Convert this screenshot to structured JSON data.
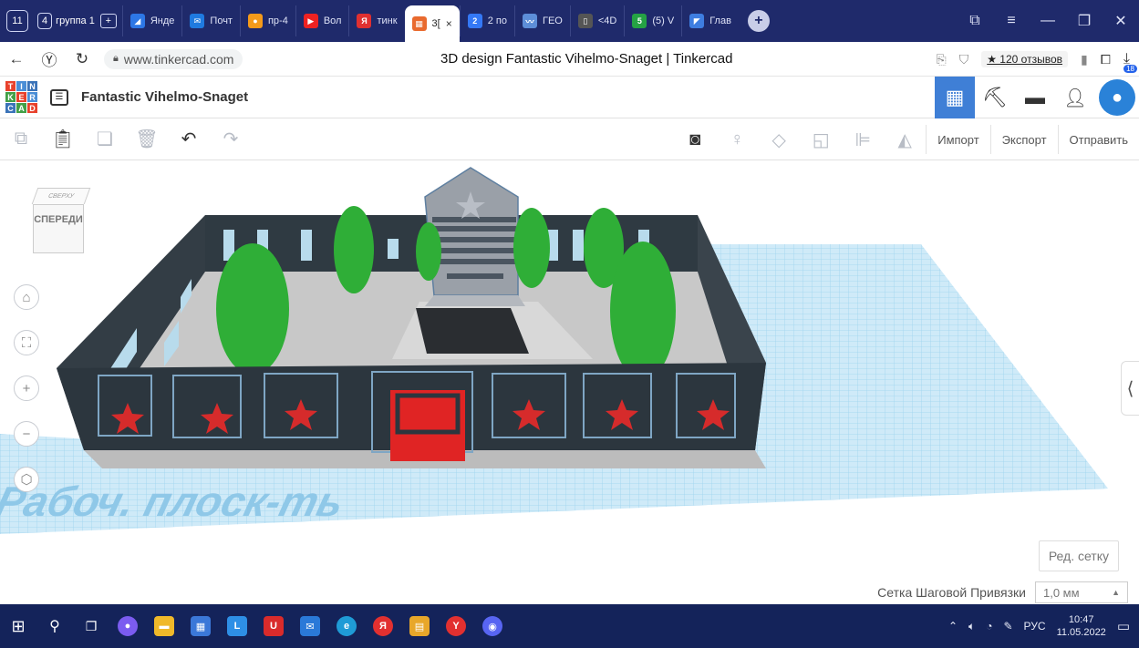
{
  "browser": {
    "tab_group_count": "4",
    "tab_group_label": "группа 1",
    "tabs": [
      {
        "label": "Янде",
        "color": "#2d77e6",
        "glyph": "◢"
      },
      {
        "label": "Почт",
        "color": "#1f7ae0",
        "glyph": "✉"
      },
      {
        "label": "пр-4",
        "color": "#f49a1a",
        "glyph": "●"
      },
      {
        "label": "Вол",
        "color": "#e22",
        "glyph": "▶"
      },
      {
        "label": "тинк",
        "color": "#e03030",
        "glyph": "Я"
      },
      {
        "label": "3[",
        "color": "#e96a2e",
        "glyph": "▦",
        "active": true
      },
      {
        "label": "2 по",
        "color": "#3478f6",
        "glyph": "2"
      },
      {
        "label": "ГЕО",
        "color": "#5d8ed8",
        "glyph": "〰"
      },
      {
        "label": "<4D",
        "color": "#555",
        "glyph": "▯"
      },
      {
        "label": "(5) V",
        "color": "#25a244",
        "glyph": "5"
      },
      {
        "label": "Глав",
        "color": "#3e7de0",
        "glyph": "◤"
      }
    ],
    "active_tab_close": "×",
    "url": "www.tinkercad.com",
    "page_title": "3D design Fantastic Vihelmo-Snaget | Tinkercad",
    "reviews": "★ 120 отзывов",
    "download_badge": "18"
  },
  "app": {
    "logo_letters": [
      "T",
      "I",
      "N",
      "K",
      "E",
      "R",
      "C",
      "A",
      "D"
    ],
    "logo_colors": [
      "#e8412c",
      "#4a8ed6",
      "#3a73b8",
      "#43a047",
      "#e8412c",
      "#4a8ed6",
      "#3a73b8",
      "#43a047",
      "#e8412c"
    ],
    "document_title": "Fantastic Vihelmo-Snaget"
  },
  "toolbar": {
    "import": "Импорт",
    "export": "Экспорт",
    "send": "Отправить"
  },
  "viewcube": {
    "top": "СВЕРХУ",
    "front": "СПЕРЕДИ"
  },
  "workplane": {
    "label": "Рабоч. плоск-ть",
    "edit_grid": "Ред. сетку",
    "snap_label": "Сетка Шаговой Привязки",
    "snap_value": "1,0 мм"
  },
  "taskbar": {
    "lang": "РУС",
    "time": "10:47",
    "date": "11.05.2022"
  }
}
